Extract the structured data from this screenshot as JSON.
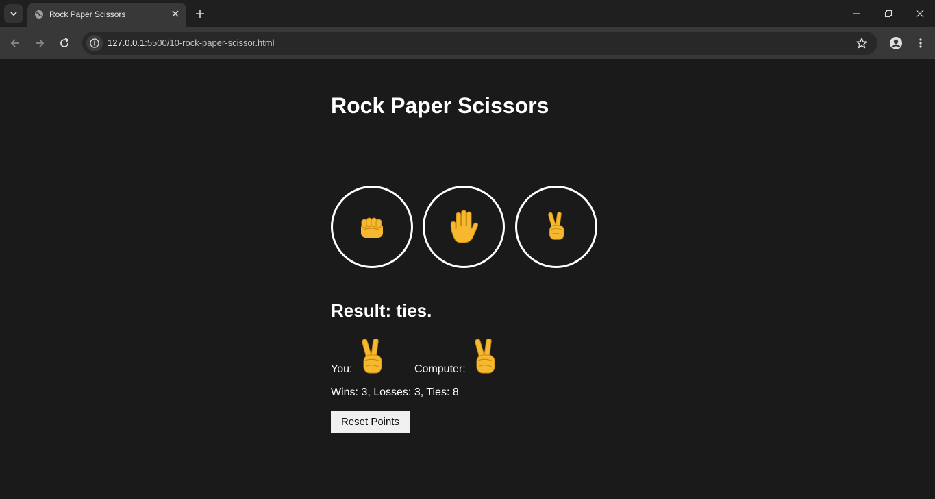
{
  "browser": {
    "tab_title": "Rock Paper Scissors",
    "url_host": "127.0.0.1",
    "url_rest": ":5500/10-rock-paper-scissor.html"
  },
  "game": {
    "title": "Rock Paper Scissors",
    "moves": [
      {
        "name": "rock",
        "icon": "rock-fist-icon"
      },
      {
        "name": "paper",
        "icon": "paper-hand-icon"
      },
      {
        "name": "scissors",
        "icon": "scissors-peace-icon"
      }
    ],
    "result_text": "Result: ties.",
    "you_label": "You:",
    "computer_label": "Computer:",
    "you_move_icon": "scissors-peace-icon",
    "computer_move_icon": "scissors-peace-icon",
    "score_text": "Wins: 3, Losses: 3, Ties: 8",
    "reset_label": "Reset Points"
  },
  "colors": {
    "page_bg": "#1a1a1a",
    "emoji_yellow": "#f5b82e",
    "circle_border": "#ffffff",
    "reset_bg": "#f0f0f0"
  }
}
